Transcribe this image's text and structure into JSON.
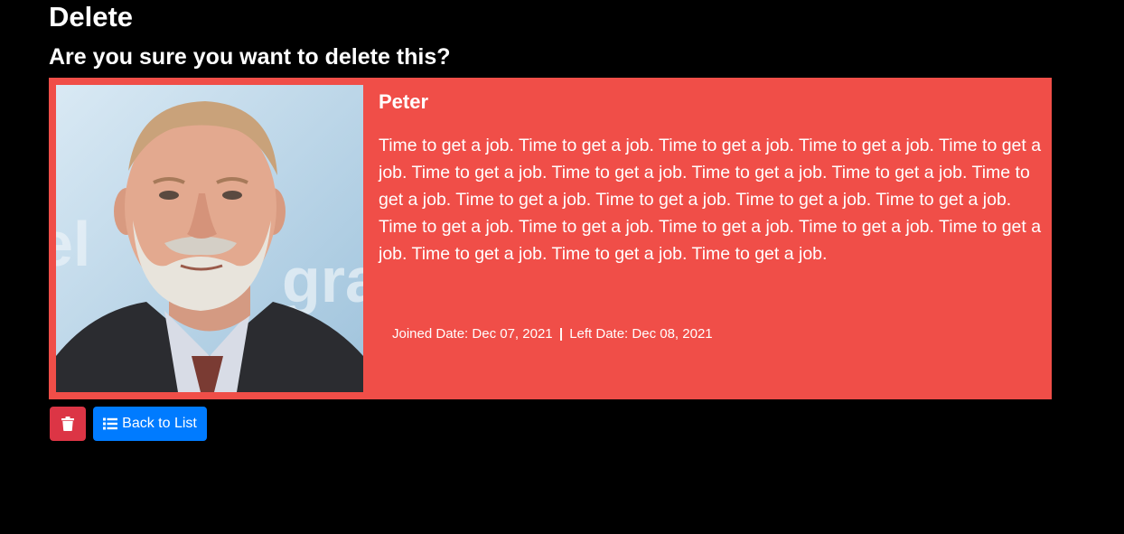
{
  "page": {
    "title": "Delete",
    "subtitle": "Are you sure you want to delete this?"
  },
  "person": {
    "name": "Peter",
    "bio": "Time to get a job. Time to get a job. Time to get a job. Time to get a job. Time to get a job. Time to get a job. Time to get a job. Time to get a job. Time to get a job. Time to get a job. Time to get a job. Time to get a job. Time to get a job. Time to get a job. Time to get a job. Time to get a job. Time to get a job. Time to get a job. Time to get a job. Time to get a job. Time to get a job. Time to get a job.",
    "joined_label": "Joined Date:",
    "joined_date": "Dec 07, 2021",
    "separator": "|",
    "left_label": "Left Date:",
    "left_date": "Dec 08, 2021",
    "photo_icon": "person-photo"
  },
  "actions": {
    "delete_icon": "trash-icon",
    "back_icon": "list-icon",
    "back_label": "Back to List"
  },
  "colors": {
    "background": "#000000",
    "card": "#f04e48",
    "delete_button": "#dc3545",
    "back_button": "#007bff"
  }
}
